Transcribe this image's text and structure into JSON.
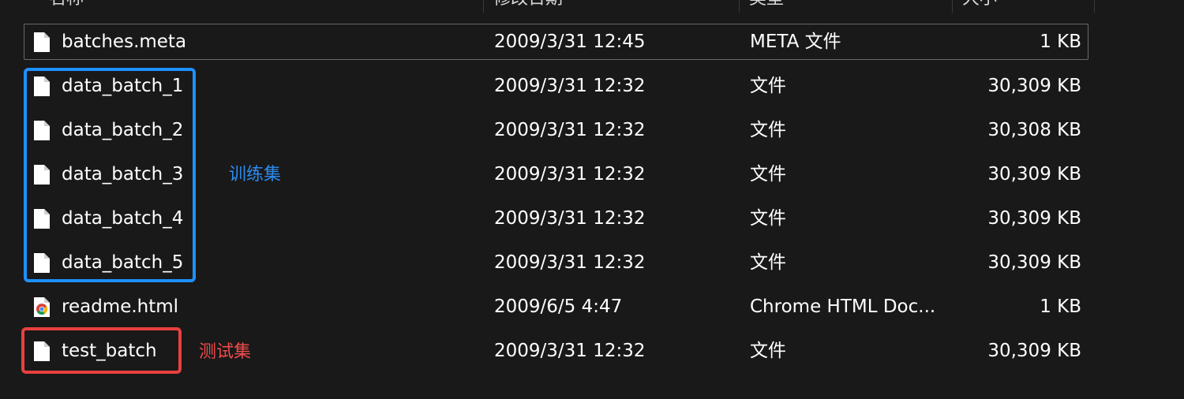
{
  "header": {
    "columns": [
      "名称",
      "修改日期",
      "类型",
      "大小"
    ]
  },
  "files": [
    {
      "name": "batches.meta",
      "date": "2009/3/31 12:45",
      "type": "META 文件",
      "size": "1 KB",
      "icon": "file-icon"
    },
    {
      "name": "data_batch_1",
      "date": "2009/3/31 12:32",
      "type": "文件",
      "size": "30,309 KB",
      "icon": "file-icon"
    },
    {
      "name": "data_batch_2",
      "date": "2009/3/31 12:32",
      "type": "文件",
      "size": "30,308 KB",
      "icon": "file-icon"
    },
    {
      "name": "data_batch_3",
      "date": "2009/3/31 12:32",
      "type": "文件",
      "size": "30,309 KB",
      "icon": "file-icon"
    },
    {
      "name": "data_batch_4",
      "date": "2009/3/31 12:32",
      "type": "文件",
      "size": "30,309 KB",
      "icon": "file-icon"
    },
    {
      "name": "data_batch_5",
      "date": "2009/3/31 12:32",
      "type": "文件",
      "size": "30,309 KB",
      "icon": "file-icon"
    },
    {
      "name": "readme.html",
      "date": "2009/6/5 4:47",
      "type": "Chrome HTML Doc...",
      "size": "1 KB",
      "icon": "chrome-html-icon"
    },
    {
      "name": "test_batch",
      "date": "2009/3/31 12:32",
      "type": "文件",
      "size": "30,309 KB",
      "icon": "file-icon"
    }
  ],
  "annotations": {
    "train_label": "训练集",
    "test_label": "测试集",
    "train_color": "#1e90ff",
    "test_color": "#e8413f"
  },
  "colors": {
    "background": "#191919",
    "text": "#ffffff",
    "focus_border": "#6a6a6a"
  }
}
